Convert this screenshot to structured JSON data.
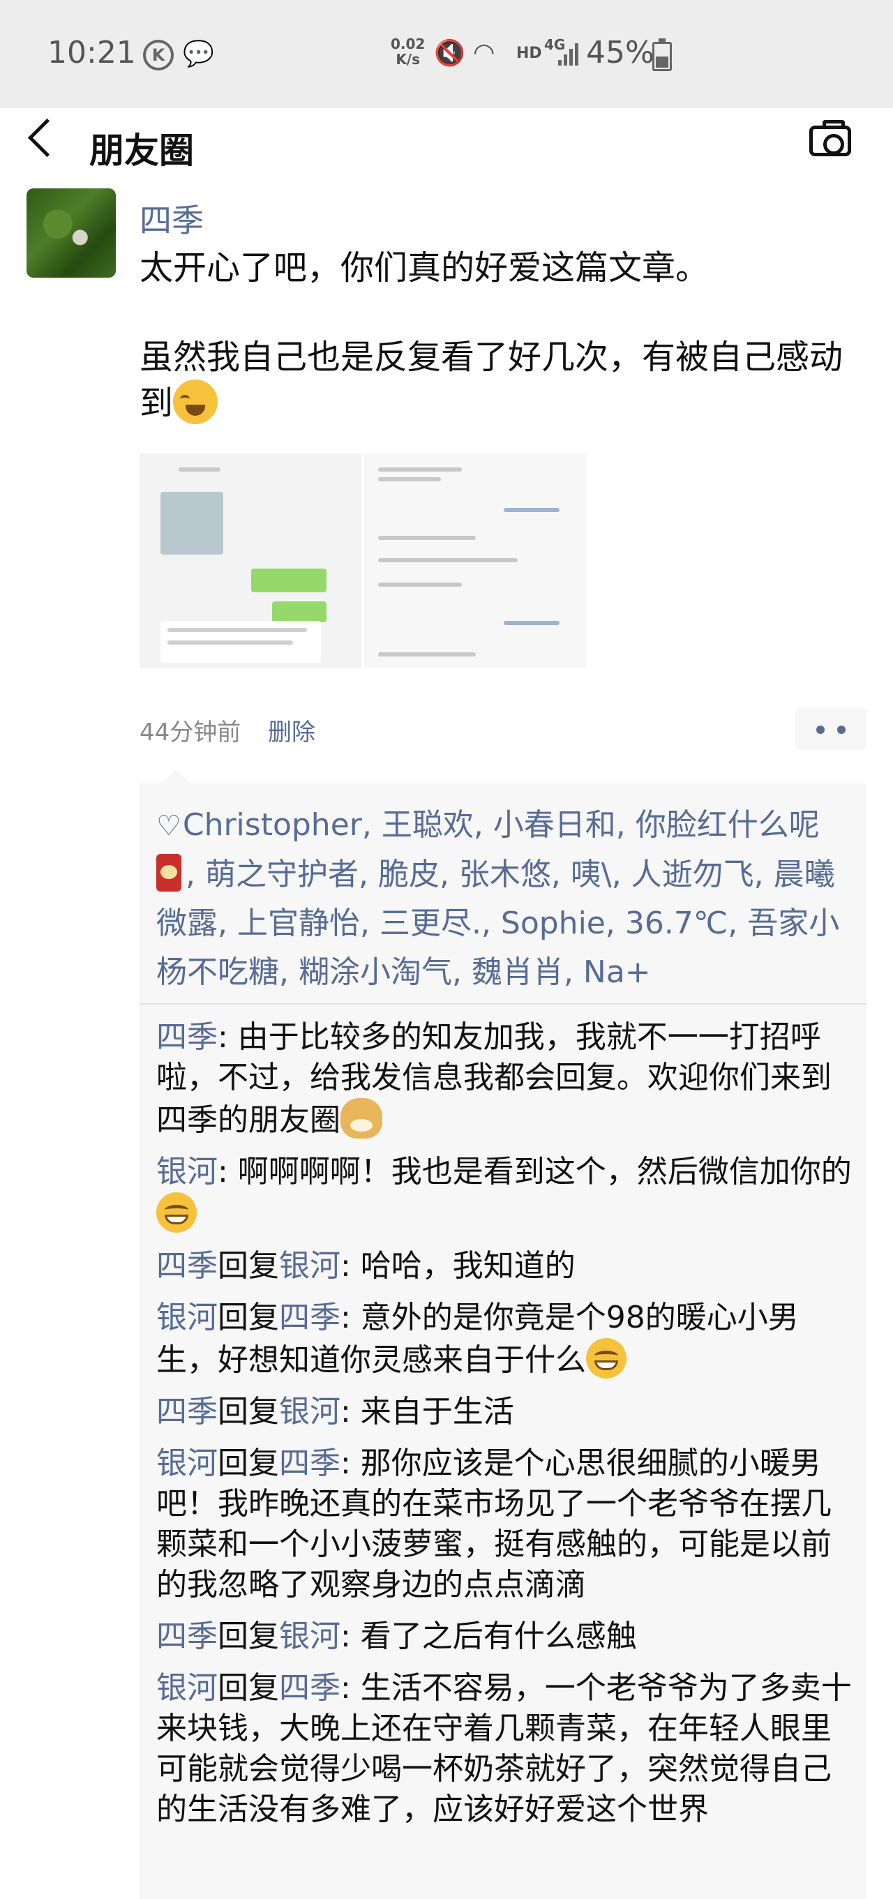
{
  "status_bar": {
    "time": "10:21",
    "net_speed_value": "0.02",
    "net_speed_unit": "K/s",
    "hd": "HD",
    "network": "4G",
    "battery": "45%"
  },
  "nav": {
    "title": "朋友圈"
  },
  "post": {
    "author": "四季",
    "text_line1": "太开心了吧，你们真的好爱这篇文章。",
    "text_line2": "虽然我自己也是反复看了好几次，有被自己感动到",
    "time": "44分钟前",
    "delete_label": "删除"
  },
  "likes": {
    "part1": "Christopher, 王聪欢, 小春日和, 你脸红什么呢",
    "part2": ", 萌之守护者, 脆皮, 张木悠, 咦\\, 人逝勿飞, 晨曦微露, 上官静怡, 三更尽., Sophie, 36.7℃, 吾家小杨不吃糖, 糊涂小淘气, 魏肖肖, Na+"
  },
  "comments": [
    {
      "from": "四季",
      "reply_word": "",
      "to": "",
      "text": ": 由于比较多的知友加我，我就不一一打招呼啦，不过，给我发信息我都会回复。欢迎你们来到四季的朋友圈"
    },
    {
      "from": "银河",
      "reply_word": "",
      "to": "",
      "text": ": 啊啊啊啊！我也是看到这个，然后微信加你的"
    },
    {
      "from": "四季",
      "reply_word": "回复",
      "to": "银河",
      "text": ": 哈哈，我知道的"
    },
    {
      "from": "银河",
      "reply_word": "回复",
      "to": "四季",
      "text": ": 意外的是你竟是个98的暖心小男生，好想知道你灵感来自于什么"
    },
    {
      "from": "四季",
      "reply_word": "回复",
      "to": "银河",
      "text": ": 来自于生活"
    },
    {
      "from": "银河",
      "reply_word": "回复",
      "to": "四季",
      "text": ": 那你应该是个心思很细腻的小暖男吧！我昨晚还真的在菜市场见了一个老爷爷在摆几颗菜和一个小小菠萝蜜，挺有感触的，可能是以前的我忽略了观察身边的点点滴滴"
    },
    {
      "from": "四季",
      "reply_word": "回复",
      "to": "银河",
      "text": ": 看了之后有什么感触"
    },
    {
      "from": "银河",
      "reply_word": "回复",
      "to": "四季",
      "text": ": 生活不容易，一个老爷爷为了多卖十来块钱，大晚上还在守着几颗青菜，在年轻人眼里可能就会觉得少喝一杯奶茶就好了，突然觉得自己的生活没有多难了，应该好好爱这个世界"
    }
  ]
}
